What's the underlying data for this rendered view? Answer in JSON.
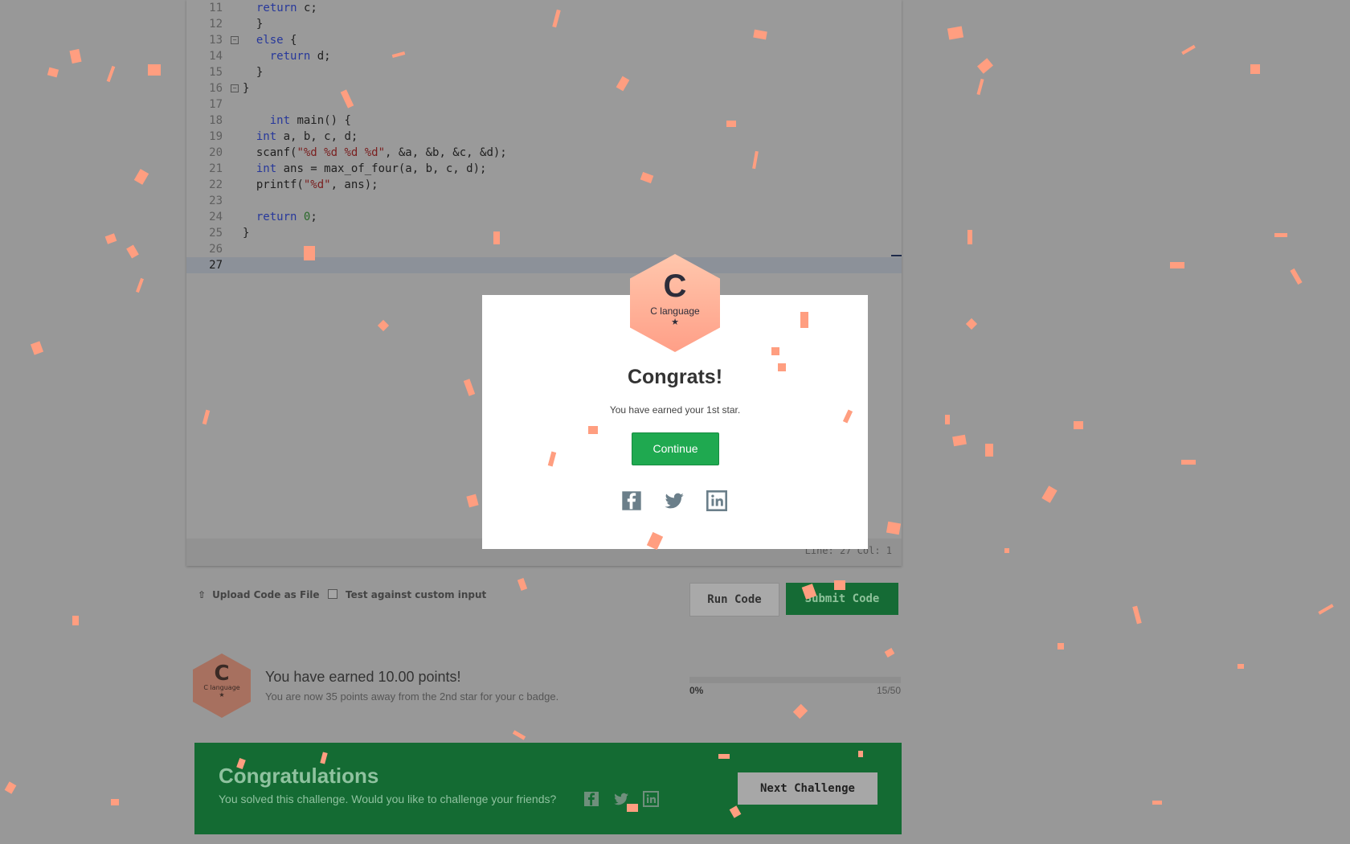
{
  "editor": {
    "status": "Line: 27 Col: 1",
    "lines": [
      {
        "n": "11",
        "code": "    return c;"
      },
      {
        "n": "12",
        "code": "  }"
      },
      {
        "n": "13",
        "code": "  else {"
      },
      {
        "n": "14",
        "code": "    return d;"
      },
      {
        "n": "15",
        "code": "  }"
      },
      {
        "n": "16",
        "code": "}"
      },
      {
        "n": "17",
        "code": ""
      },
      {
        "n": "18",
        "code": "    int main() {"
      },
      {
        "n": "19",
        "code": "  int a, b, c, d;"
      },
      {
        "n": "20",
        "code": "  scanf(\"%d %d %d %d\", &a, &b, &c, &d);"
      },
      {
        "n": "21",
        "code": "  int ans = max_of_four(a, b, c, d);"
      },
      {
        "n": "22",
        "code": "  printf(\"%d\", ans);"
      },
      {
        "n": "23",
        "code": ""
      },
      {
        "n": "24",
        "code": "  return 0;"
      },
      {
        "n": "25",
        "code": "}"
      },
      {
        "n": "26",
        "code": ""
      },
      {
        "n": "27",
        "code": ""
      }
    ]
  },
  "toolbar": {
    "upload_label": "Upload Code as File",
    "custom_input_label": "Test against custom input",
    "run_label": "Run Code",
    "submit_label": "Submit Code"
  },
  "points": {
    "badge_letter": "C",
    "badge_name": "C language",
    "badge_star": "★",
    "title": "You have earned 10.00 points!",
    "subtitle": "You are now 35 points away from the 2nd star for your c badge.",
    "progress_pct_label": "0%",
    "progress_count": "15/50",
    "progress_fraction": 0
  },
  "banner": {
    "title": "Congratulations",
    "subtitle": "You solved this challenge. Would you like to challenge your friends?",
    "next_label": "Next Challenge"
  },
  "modal": {
    "badge_letter": "C",
    "badge_name": "C language",
    "badge_star": "★",
    "title": "Congrats!",
    "subtitle": "You have earned your 1st star.",
    "continue_label": "Continue"
  },
  "icons": {
    "social": [
      "facebook-icon",
      "twitter-icon",
      "linkedin-icon"
    ]
  },
  "colors": {
    "accent_green": "#1fa950",
    "confetti": "#ff9e80",
    "badge": "#ffb59c"
  }
}
